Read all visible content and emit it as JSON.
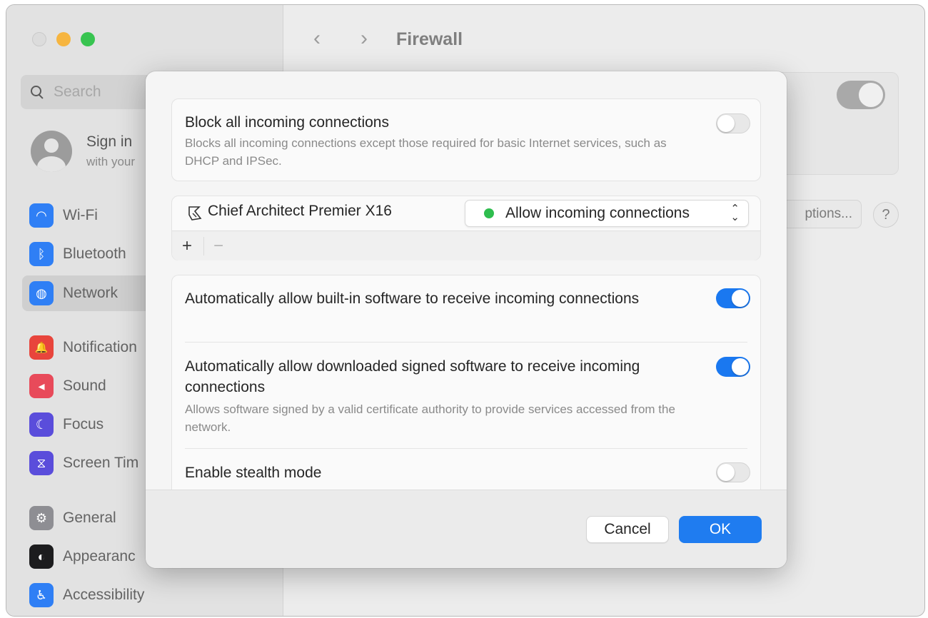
{
  "window": {
    "title": "Firewall",
    "back_glyph": "‹",
    "forward_glyph": "›"
  },
  "sidebar": {
    "search_placeholder": "Search",
    "account": {
      "title": "Sign in",
      "subtitle": "with your"
    },
    "items": [
      {
        "label": "Wi-Fi",
        "icon": "wifi-icon",
        "color": "#2f7ff5",
        "glyph": "◠"
      },
      {
        "label": "Bluetooth",
        "icon": "bluetooth-icon",
        "color": "#2f7ff5",
        "glyph": "ᛒ"
      },
      {
        "label": "Network",
        "icon": "globe-icon",
        "color": "#2f7ff5",
        "glyph": "◍"
      },
      {
        "label": "Notification",
        "icon": "bell-icon",
        "color": "#e8453c",
        "glyph": "🔔"
      },
      {
        "label": "Sound",
        "icon": "speaker-icon",
        "color": "#e84a5a",
        "glyph": "◂"
      },
      {
        "label": "Focus",
        "icon": "moon-icon",
        "color": "#5a4ddb",
        "glyph": "☾"
      },
      {
        "label": "Screen Tim",
        "icon": "hourglass-icon",
        "color": "#5a4ddb",
        "glyph": "⧖"
      },
      {
        "label": "General",
        "icon": "gear-icon",
        "color": "#8e8e93",
        "glyph": "⚙"
      },
      {
        "label": "Appearanc",
        "icon": "appearance-icon",
        "color": "#1c1c1e",
        "glyph": "◐"
      },
      {
        "label": "Accessibility",
        "icon": "accessibility-icon",
        "color": "#2f7ff5",
        "glyph": "♿"
      }
    ],
    "selected": "Network"
  },
  "background": {
    "options_label": "ptions...",
    "help_label": "?"
  },
  "sheet": {
    "block_all": {
      "title": "Block all incoming connections",
      "description": "Blocks all incoming connections except those required for basic Internet services, such as DHCP and IPSec.",
      "enabled": false
    },
    "apps": [
      {
        "name": "Chief Architect Premier X16",
        "setting": "Allow incoming connections",
        "status_color": "#2ebd4e"
      }
    ],
    "list_tools": {
      "add": "+",
      "remove": "−"
    },
    "options": [
      {
        "title": "Automatically allow built-in software to receive incoming connections",
        "description": "",
        "enabled": true
      },
      {
        "title": "Automatically allow downloaded signed software to receive incoming connections",
        "description": "Allows software signed by a valid certificate authority to provide services accessed from the network.",
        "enabled": true
      },
      {
        "title": "Enable stealth mode",
        "description": "",
        "enabled": false
      }
    ],
    "buttons": {
      "cancel": "Cancel",
      "ok": "OK"
    }
  }
}
